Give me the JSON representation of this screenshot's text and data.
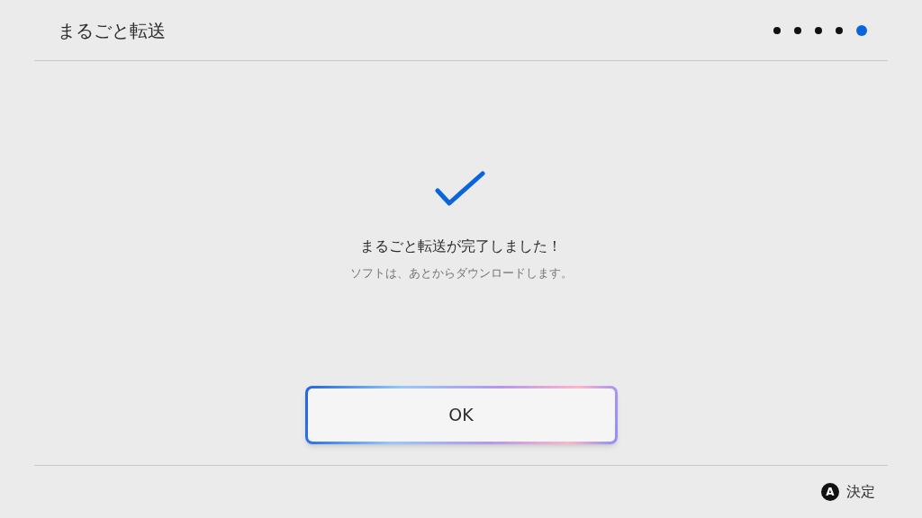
{
  "header": {
    "title": "まるごと転送",
    "steps": [
      {
        "selected": false
      },
      {
        "selected": false
      },
      {
        "selected": false
      },
      {
        "selected": false
      },
      {
        "selected": true
      }
    ]
  },
  "message": {
    "title": "まるごと転送が完了しました！",
    "subtitle": "ソフトは、あとからダウンロードします。"
  },
  "button": {
    "label": "OK",
    "focused": true
  },
  "footer": {
    "hints": [
      {
        "key": "A",
        "label": "決定"
      }
    ]
  }
}
